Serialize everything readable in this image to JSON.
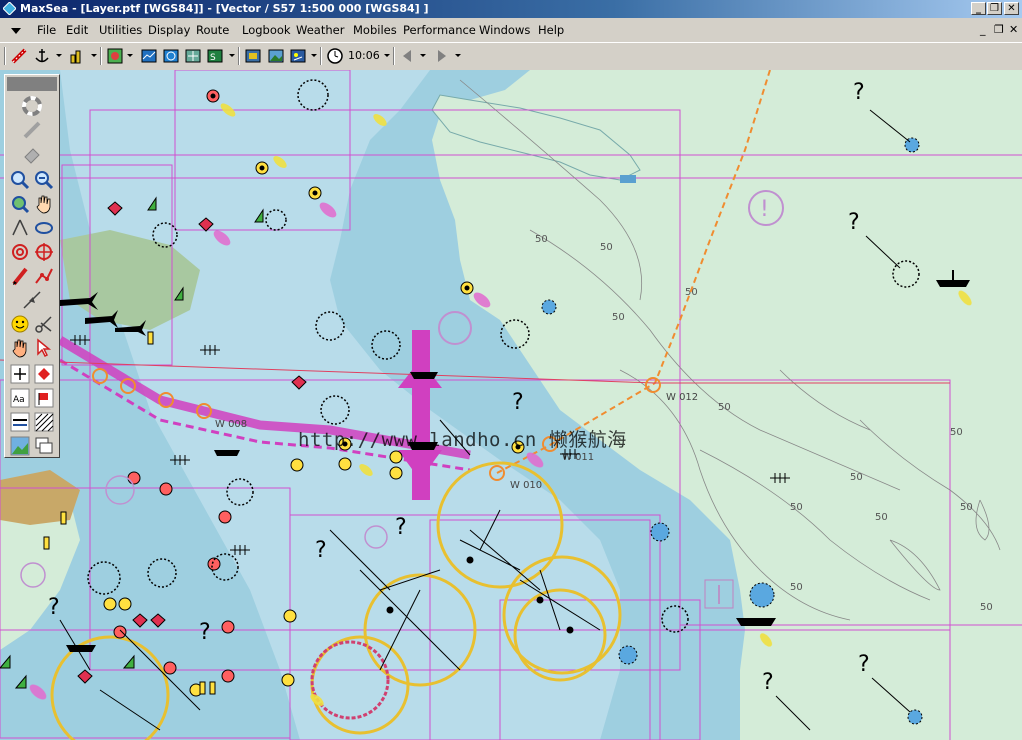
{
  "window": {
    "title": "MaxSea - [Layer.ptf [WGS84]] - [Vector / S57  1:500 000 [WGS84] ]",
    "buttons": [
      "_",
      "❐",
      "✕"
    ]
  },
  "menu": {
    "items": [
      "File",
      "Edit",
      "Utilities",
      "Display",
      "Route",
      "Logbook",
      "Weather",
      "Mobiles",
      "Performance",
      "Windows",
      "Help"
    ],
    "mdi_buttons": [
      "_",
      "❐",
      "✕"
    ]
  },
  "toolbar": {
    "clock_icon": "clock-icon",
    "time": "10:06",
    "icons": [
      "ruler-icon",
      "anchor-icon",
      "tide-icon",
      "layers-icon",
      "chart-icon",
      "radar-icon",
      "grib-icon",
      "overlay-icon",
      "grid-icon",
      "clock-icon",
      "back-icon",
      "forward-icon"
    ]
  },
  "chart": {
    "watermark": "http://www.landho.cn 懒猴航海",
    "waypoints": [
      "W 012",
      "W 011",
      "W 010",
      "W 008"
    ],
    "depth_contour": "50",
    "colors": {
      "land": "#d4ecd8",
      "shallow_water": "#9ecfe0",
      "deep_water": "#b8dcea",
      "magenta": "#d040c0",
      "route": "#f08c30",
      "limit_lines": "#d050d0"
    }
  },
  "palette": {
    "tools": [
      "lifebuoy-icon",
      "pencil-icon",
      "eraser-icon",
      "zoom-in-icon",
      "zoom-out-icon",
      "zoom-box-icon",
      "pan-hand-icon",
      "measure-icon",
      "rotate-icon",
      "target-icon",
      "crosshair-icon",
      "draw-icon",
      "route-icon",
      "boat-icon",
      "scissors-icon",
      "smiley-icon",
      "cut-icon",
      "hand-select-icon",
      "pointer-icon",
      "cross-icon",
      "diamond-icon",
      "text-icon",
      "flag-icon",
      "line-style-icon",
      "pattern-icon",
      "image-icon",
      "window-icon"
    ]
  }
}
